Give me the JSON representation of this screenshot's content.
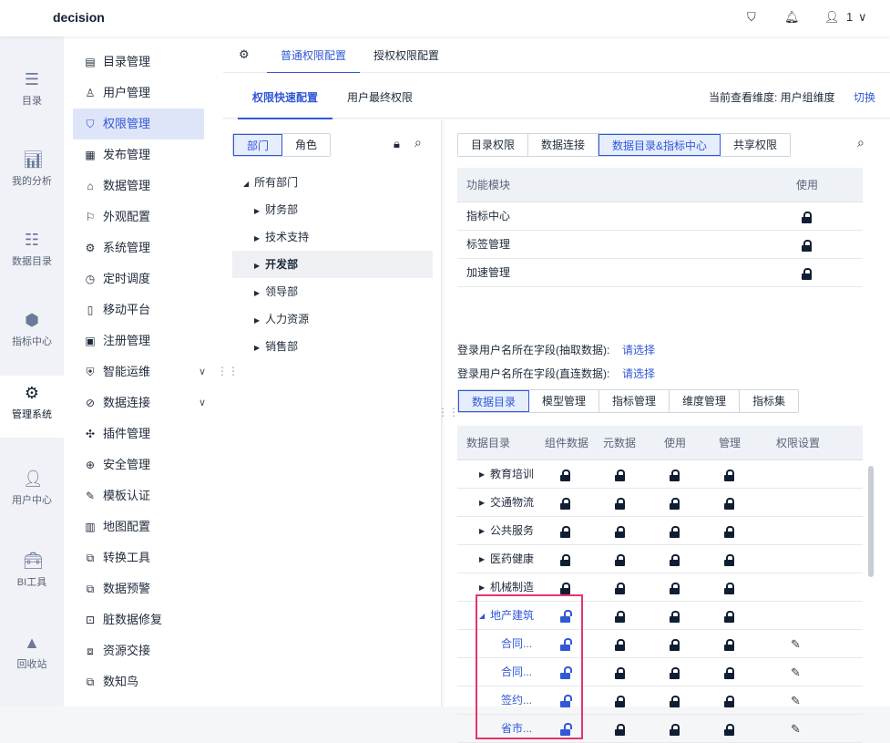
{
  "app": {
    "title": "decision",
    "user": "1"
  },
  "rail": [
    {
      "label": "目录",
      "icon": "list-icon"
    },
    {
      "label": "我的分析",
      "icon": "chart-icon"
    },
    {
      "label": "数据目录",
      "icon": "database-icon"
    },
    {
      "label": "指标中心",
      "icon": "cubes-icon"
    },
    {
      "label": "管理系统",
      "icon": "gear-icon",
      "active": true
    },
    {
      "label": "用户中心",
      "icon": "user-icon"
    },
    {
      "label": "BI工具",
      "icon": "toolbox-icon"
    },
    {
      "label": "回收站",
      "icon": "recycle-icon"
    }
  ],
  "sidebar": [
    {
      "label": "目录管理"
    },
    {
      "label": "用户管理"
    },
    {
      "label": "权限管理",
      "active": true
    },
    {
      "label": "发布管理"
    },
    {
      "label": "数据管理"
    },
    {
      "label": "外观配置"
    },
    {
      "label": "系统管理"
    },
    {
      "label": "定时调度"
    },
    {
      "label": "移动平台"
    },
    {
      "label": "注册管理"
    },
    {
      "label": "智能运维",
      "expand": true
    },
    {
      "label": "数据连接",
      "expand": true
    },
    {
      "label": "插件管理"
    },
    {
      "label": "安全管理"
    },
    {
      "label": "模板认证"
    },
    {
      "label": "地图配置"
    },
    {
      "label": "转换工具"
    },
    {
      "label": "数据预警"
    },
    {
      "label": "脏数据修复"
    },
    {
      "label": "资源交接"
    },
    {
      "label": "数知鸟"
    }
  ],
  "tabs": {
    "t1": "普通权限配置",
    "t2": "授权权限配置",
    "sub1": "权限快速配置",
    "sub2": "用户最终权限",
    "dim_label": "当前查看维度: 用户组维度",
    "switch": "切换"
  },
  "left": {
    "seg": [
      "部门",
      "角色"
    ],
    "tree": [
      "所有部门",
      "财务部",
      "技术支持",
      "开发部",
      "领导部",
      "人力资源",
      "销售部"
    ]
  },
  "right": {
    "tabs": [
      "目录权限",
      "数据连接",
      "数据目录&指标中心",
      "共享权限"
    ],
    "func_header": [
      "功能模块",
      "使用"
    ],
    "func_rows": [
      "指标中心",
      "标签管理",
      "加速管理"
    ],
    "field1": "登录用户名所在字段(抽取数据):",
    "field2": "登录用户名所在字段(直连数据):",
    "choose": "请选择",
    "subtabs": [
      "数据目录",
      "模型管理",
      "指标管理",
      "维度管理",
      "指标集"
    ],
    "headers": [
      "数据目录",
      "组件数据",
      "元数据",
      "使用",
      "管理",
      "权限设置"
    ],
    "rows": [
      {
        "name": "教育培训",
        "lv": 1
      },
      {
        "name": "交通物流",
        "lv": 1
      },
      {
        "name": "公共服务",
        "lv": 1
      },
      {
        "name": "医药健康",
        "lv": 1
      },
      {
        "name": "机械制造",
        "lv": 1
      },
      {
        "name": "地产建筑",
        "lv": 1,
        "open": true
      },
      {
        "name": "合同...",
        "lv": 2
      },
      {
        "name": "合同...",
        "lv": 2
      },
      {
        "name": "签约...",
        "lv": 2
      },
      {
        "name": "省市...",
        "lv": 2
      }
    ]
  },
  "colors": {
    "accent": "#3158d6",
    "highlight": "#e8336d"
  }
}
